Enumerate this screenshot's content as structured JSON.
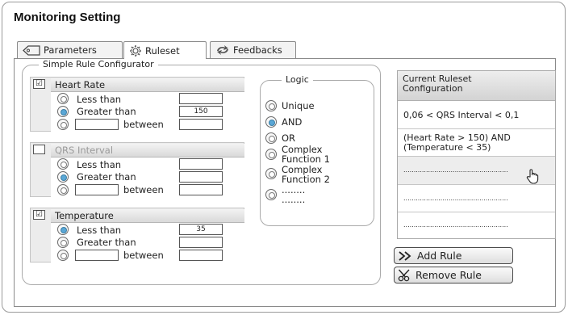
{
  "app": {
    "title": "Monitoring Setting"
  },
  "tabs": [
    {
      "label": "Parameters",
      "icon": "tag-icon"
    },
    {
      "label": "Ruleset",
      "icon": "gear-icon",
      "active": true
    },
    {
      "label": "Feedbacks",
      "icon": "arrows-icon"
    }
  ],
  "configurator": {
    "title": "Simple Rule Configurator",
    "sections": [
      {
        "label": "Heart Rate",
        "checked": true,
        "enabled": true,
        "less_than": "",
        "greater_than": "150",
        "between_from": "",
        "between_to": "",
        "selected": "greater_than"
      },
      {
        "label": "QRS Interval",
        "checked": false,
        "enabled": false,
        "less_than": "",
        "greater_than": "",
        "between_from": "",
        "between_to": "",
        "selected": "greater_than"
      },
      {
        "label": "Temperature",
        "checked": true,
        "enabled": true,
        "less_than": "35",
        "greater_than": "",
        "between_from": "",
        "between_to": "",
        "selected": "less_than"
      }
    ],
    "option_labels": {
      "less_than": "Less than",
      "greater_than": "Greater than",
      "between": "between"
    }
  },
  "logic": {
    "title": "Logic",
    "options": [
      "Unique",
      "AND",
      "OR",
      "Complex\nFunction 1",
      "Complex\nFunction 2",
      "........\n........"
    ],
    "selected": "AND"
  },
  "ruleset": {
    "title": "Current Ruleset\nConfiguration",
    "rules": [
      "0,06 < QRS Interval < 0,1",
      "(Heart Rate > 150) AND\n(Temperature < 35)",
      "...................................................",
      "...................................................",
      "..................................................."
    ]
  },
  "buttons": {
    "add_rule": "Add Rule",
    "remove_rule": "Remove Rule"
  }
}
